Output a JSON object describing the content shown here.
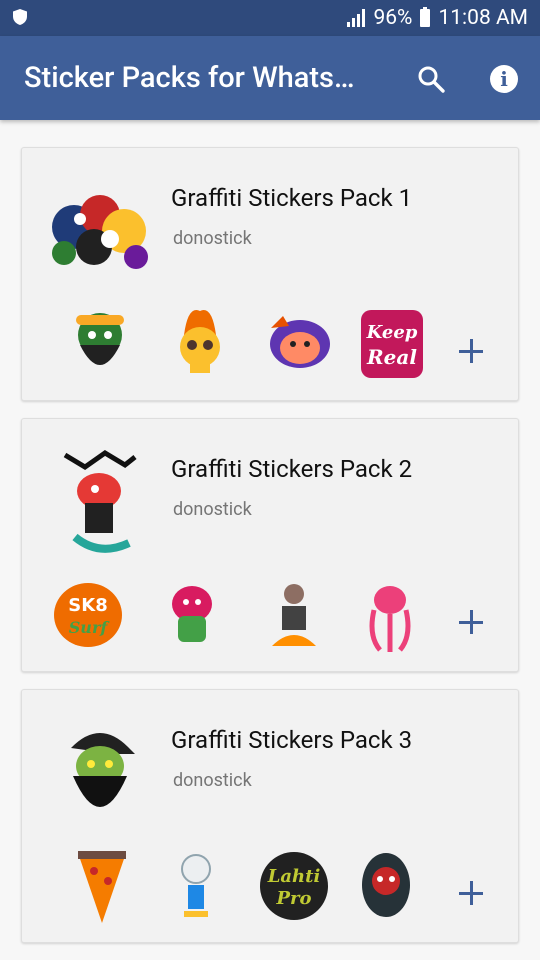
{
  "status_bar": {
    "battery_percent": "96%",
    "time": "11:08 AM"
  },
  "app_bar": {
    "title": "Sticker Packs for Whats…"
  },
  "packs": [
    {
      "name": "Graffiti Stickers Pack 1",
      "author": "donostick",
      "tray_icon": "graffiti-collage",
      "previews": [
        "bearded-head-headphones",
        "flaming-skull",
        "purple-monkey-head",
        "keep-it-real-lettering"
      ]
    },
    {
      "name": "Graffiti Stickers Pack 2",
      "author": "donostick",
      "tray_icon": "graffiti-character-tag",
      "previews": [
        "sk8-or-surf-lettering",
        "pink-monster",
        "breakdancer",
        "pink-octopus-tag"
      ]
    },
    {
      "name": "Graffiti Stickers Pack 3",
      "author": "donostick",
      "tray_icon": "zombie-beard-cap",
      "previews": [
        "pizza-slice-monster",
        "skeleton-boombox",
        "lahti-pro-lettering",
        "red-graffiti-face"
      ]
    }
  ],
  "colors": {
    "status_bar": "#2f4a7c",
    "app_bar": "#3f5f99",
    "add_icon": "#3f5f99",
    "card_bg": "#f2f2f2",
    "author_text": "#757575"
  }
}
